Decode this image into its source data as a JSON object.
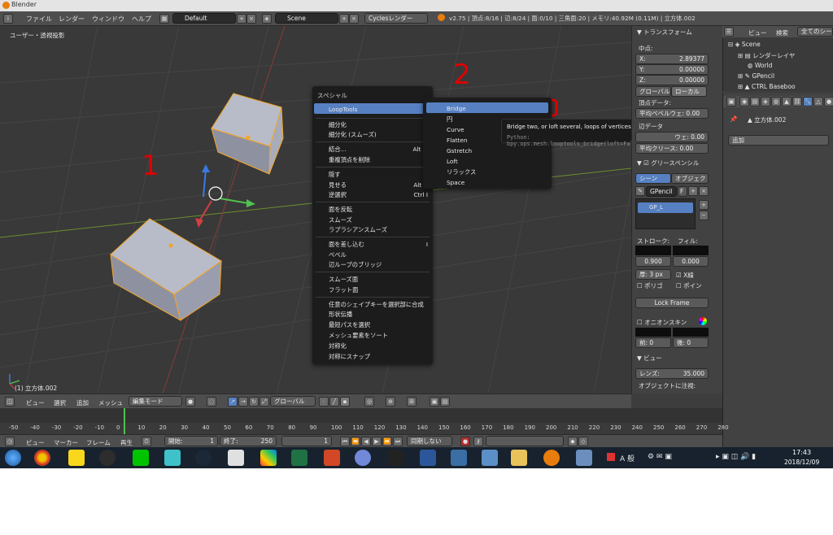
{
  "title_bar": {
    "title": "Blender"
  },
  "info_header": {
    "menus": [
      "ファイル",
      "レンダー",
      "ウィンドウ",
      "ヘルプ"
    ],
    "layout": "Default",
    "scene": "Scene",
    "engine": "Cyclesレンダー",
    "stats": "v2.75 | 頂点:8/16 | 辺:8/24 | 面:0/10 | 三角面:20 | メモリ:40.92M (0.11M) | 立方体.002"
  },
  "viewport": {
    "view_name": "ユーザー・透視投影",
    "object_name": "(1) 立方体.002",
    "annotation_1": "1",
    "annotation_2": "2"
  },
  "special_menu": {
    "title": "スペシャル",
    "items": [
      {
        "label": "LoopTools",
        "shortcut": ""
      },
      {
        "label": "細分化",
        "shortcut": ""
      },
      {
        "label": "細分化 (スムーズ)",
        "shortcut": ""
      },
      {
        "label": "結合...",
        "shortcut": "Alt M"
      },
      {
        "label": "重複頂点を削除",
        "shortcut": ""
      },
      {
        "label": "隠す",
        "shortcut": "H"
      },
      {
        "label": "見せる",
        "shortcut": "Alt H"
      },
      {
        "label": "逆選択",
        "shortcut": "Ctrl I"
      },
      {
        "label": "面を反転",
        "shortcut": ""
      },
      {
        "label": "スムーズ",
        "shortcut": ""
      },
      {
        "label": "ラプラシアンスムーズ",
        "shortcut": ""
      },
      {
        "label": "面を差し込む",
        "shortcut": "I"
      },
      {
        "label": "ベベル",
        "shortcut": ""
      },
      {
        "label": "辺ループのブリッジ",
        "shortcut": ""
      },
      {
        "label": "スムーズ面",
        "shortcut": ""
      },
      {
        "label": "フラット面",
        "shortcut": ""
      },
      {
        "label": "任意のシェイプキーを選択部に合成",
        "shortcut": ""
      },
      {
        "label": "形状伝播",
        "shortcut": ""
      },
      {
        "label": "最短パスを選択",
        "shortcut": ""
      },
      {
        "label": "メッシュ要素をソート",
        "shortcut": ""
      },
      {
        "label": "対称化",
        "shortcut": ""
      },
      {
        "label": "対称にスナップ",
        "shortcut": ""
      }
    ]
  },
  "looptools_menu": {
    "items": [
      "Bridge",
      "円",
      "Curve",
      "Flatten",
      "Gstretch",
      "Loft",
      "リラックス",
      "Space"
    ]
  },
  "tooltip": {
    "text": "Bridge two, or loft several, loops of vertices",
    "python": "Python: bpy.ops.mesh.looptools_bridge(loft=False)"
  },
  "n_panel": {
    "transform_header": "トランスフォーム",
    "median_label": "中点:",
    "x": "X:",
    "x_val": "2.89377",
    "y": "Y:",
    "y_val": "0.00000",
    "z": "Z:",
    "z_val": "0.00000",
    "global": "グローバル",
    "local": "ローカル",
    "vertex_data": "頂点データ:",
    "mean_bevel": "平均ベベルウェ: 0.00",
    "edge_data": "辺データ",
    "mean_bevel2": "ウェ: 0.00",
    "mean_crease": "平均クリース: 0.00",
    "gp_header": "グリースペンシル",
    "scene_tab": "シーン",
    "object_tab": "オブジェクト",
    "gp_name": "GPencil",
    "gp_f": "F",
    "gp_layer": "GP_L",
    "stroke": "ストローク:",
    "fill": "フィル:",
    "stroke_val": "0.900",
    "fill_val": "0.000",
    "thickness": "厚: 3 px",
    "xray": "X線",
    "poly": "ポリゴ",
    "point": "ポイン",
    "lock_frame": "Lock Frame",
    "onion": "オニオンスキン",
    "before": "前: 0",
    "after": "後: 0",
    "view_header": "ビュー",
    "lens": "レンズ:",
    "lens_val": "35.000",
    "lock_to_object": "オブジェクトに注視:"
  },
  "outliner": {
    "menus": [
      "ビュー",
      "検索"
    ],
    "filter": "全てのシーン",
    "items": [
      "Scene",
      "レンダーレイヤ",
      "World",
      "GPencil",
      "CTRL Baseboo"
    ]
  },
  "properties": {
    "object_name": "立方体.002",
    "add_modifier": "追加"
  },
  "viewport_header": {
    "menus": [
      "ビュー",
      "選択",
      "追加",
      "メッシュ"
    ],
    "mode": "編集モード",
    "orientation": "グローバル"
  },
  "timeline": {
    "ticks": [
      "-50",
      "-40",
      "-30",
      "-20",
      "-10",
      "0",
      "10",
      "20",
      "30",
      "40",
      "50",
      "60",
      "70",
      "80",
      "90",
      "100",
      "110",
      "120",
      "130",
      "140",
      "150",
      "160",
      "170",
      "180",
      "190",
      "200",
      "210",
      "220",
      "230",
      "240",
      "250",
      "260",
      "270",
      "280"
    ],
    "menus": [
      "ビュー",
      "マーカー",
      "フレーム",
      "再生"
    ],
    "start_label": "開始:",
    "start_val": "1",
    "end_label": "終了:",
    "end_val": "250",
    "current": "1",
    "sync": "同期しない"
  },
  "taskbar": {
    "time": "17:43",
    "date": "2018/12/09",
    "ime": "A 般"
  },
  "colors": {
    "highlight": "#5680c2",
    "annotation": "#e00000",
    "selection": "#f5a623"
  }
}
